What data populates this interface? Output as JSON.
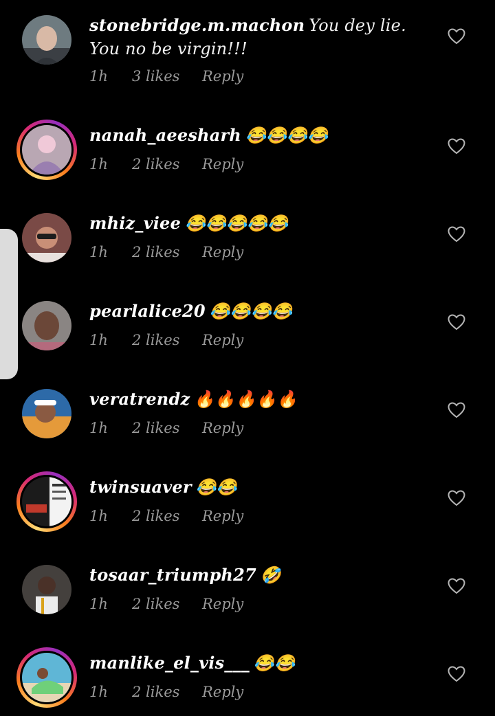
{
  "comments": [
    {
      "username": "stonebridge.m.machon",
      "text": "You dey lie. You no be virgin!!!",
      "time": "1h",
      "likes": "3 likes",
      "reply": "Reply"
    },
    {
      "username": "nanah_aeesharh",
      "text": "😂😂😂😂",
      "time": "1h",
      "likes": "2 likes",
      "reply": "Reply"
    },
    {
      "username": "mhiz_viee",
      "text": "😂😂😂😂😂",
      "time": "1h",
      "likes": "2 likes",
      "reply": "Reply"
    },
    {
      "username": "pearlalice20",
      "text": "😂😂😂😂",
      "time": "1h",
      "likes": "2 likes",
      "reply": "Reply"
    },
    {
      "username": "veratrendz",
      "text": "🔥🔥🔥🔥🔥",
      "time": "1h",
      "likes": "2 likes",
      "reply": "Reply"
    },
    {
      "username": "twinsuaver",
      "text": "😂😂",
      "time": "1h",
      "likes": "2 likes",
      "reply": "Reply"
    },
    {
      "username": "tosaar_triumph27",
      "text": "🤣",
      "time": "1h",
      "likes": "2 likes",
      "reply": "Reply"
    },
    {
      "username": "manlike_el_vis___",
      "text": "😂😂",
      "time": "1h",
      "likes": "2 likes",
      "reply": "Reply"
    }
  ],
  "colors": {
    "background": "#000000",
    "meta_text": "#9a9a9a",
    "story_ring": "#d62976"
  },
  "icons": {
    "like": "heart-outline-icon"
  }
}
